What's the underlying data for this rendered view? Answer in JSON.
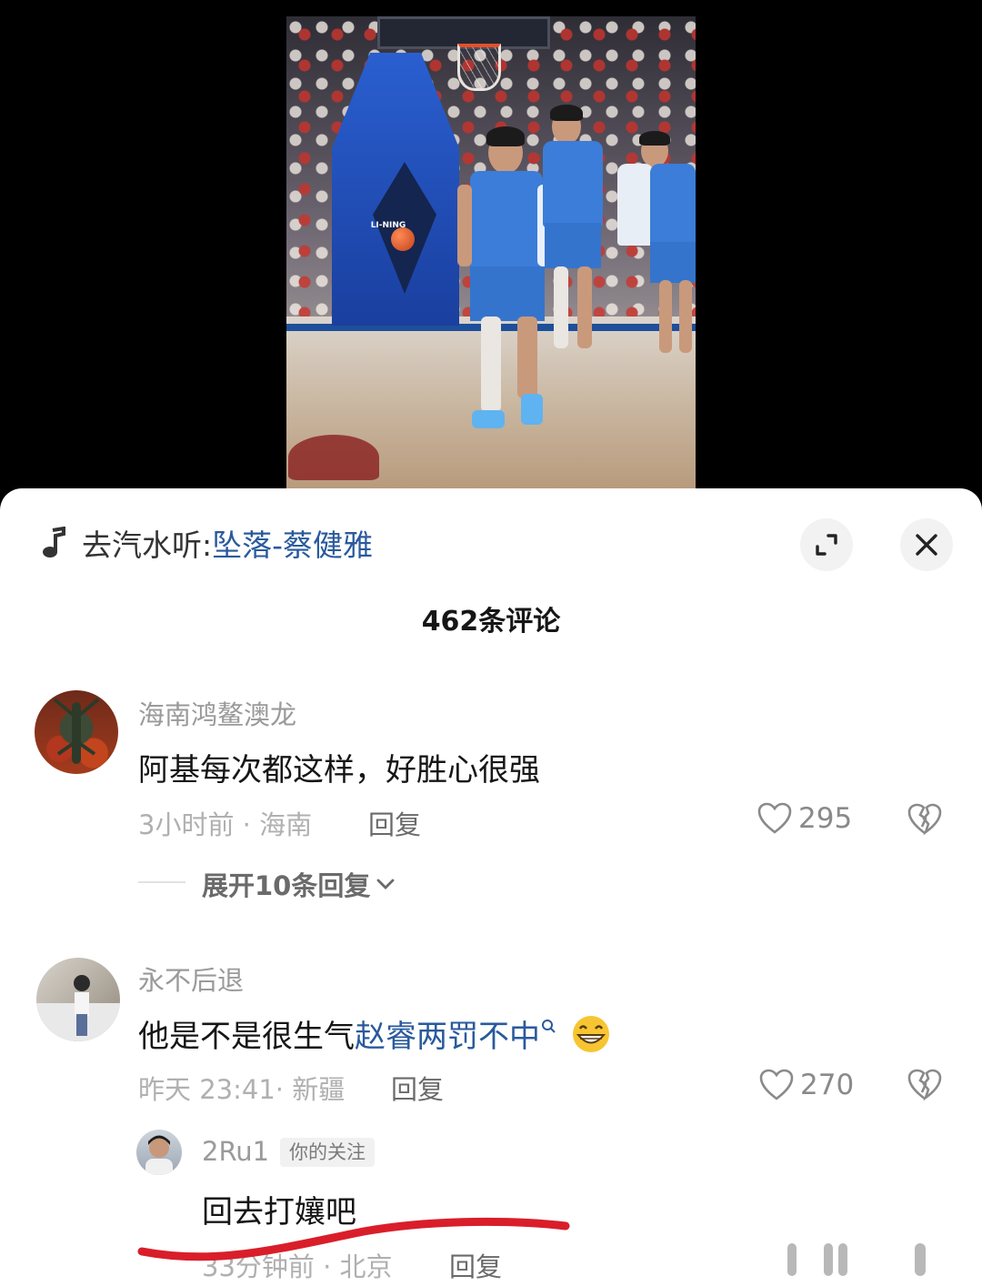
{
  "music": {
    "prefix": "去汽水听:",
    "song": "坠落-蔡健雅",
    "icon": "music-note-icon"
  },
  "header": {
    "comment_count": "462条评论",
    "expand_icon": "expand-icon",
    "close_icon": "close-icon"
  },
  "video": {
    "brand": "LI-NING"
  },
  "comments": [
    {
      "username": "海南鸿鳌澳龙",
      "text": "阿基每次都这样，好胜心很强",
      "meta": "3小时前 · 海南",
      "reply_label": "回复",
      "likes": "295",
      "expand_label": "展开10条回复"
    },
    {
      "username": "永不后退",
      "text_plain": "他是不是很生气",
      "text_link": "赵睿两罚不中",
      "emoji": "😁",
      "meta": "昨天 23:41· 新疆",
      "reply_label": "回复",
      "likes": "270"
    }
  ],
  "reply": {
    "username": "2Ru1",
    "badge": "你的关注",
    "text": "回去打孃吧",
    "meta": "33分钟前 · 北京",
    "reply_label": "回复"
  },
  "colors": {
    "link": "#2a5a9c",
    "underline_annotation": "#d91e2a"
  }
}
